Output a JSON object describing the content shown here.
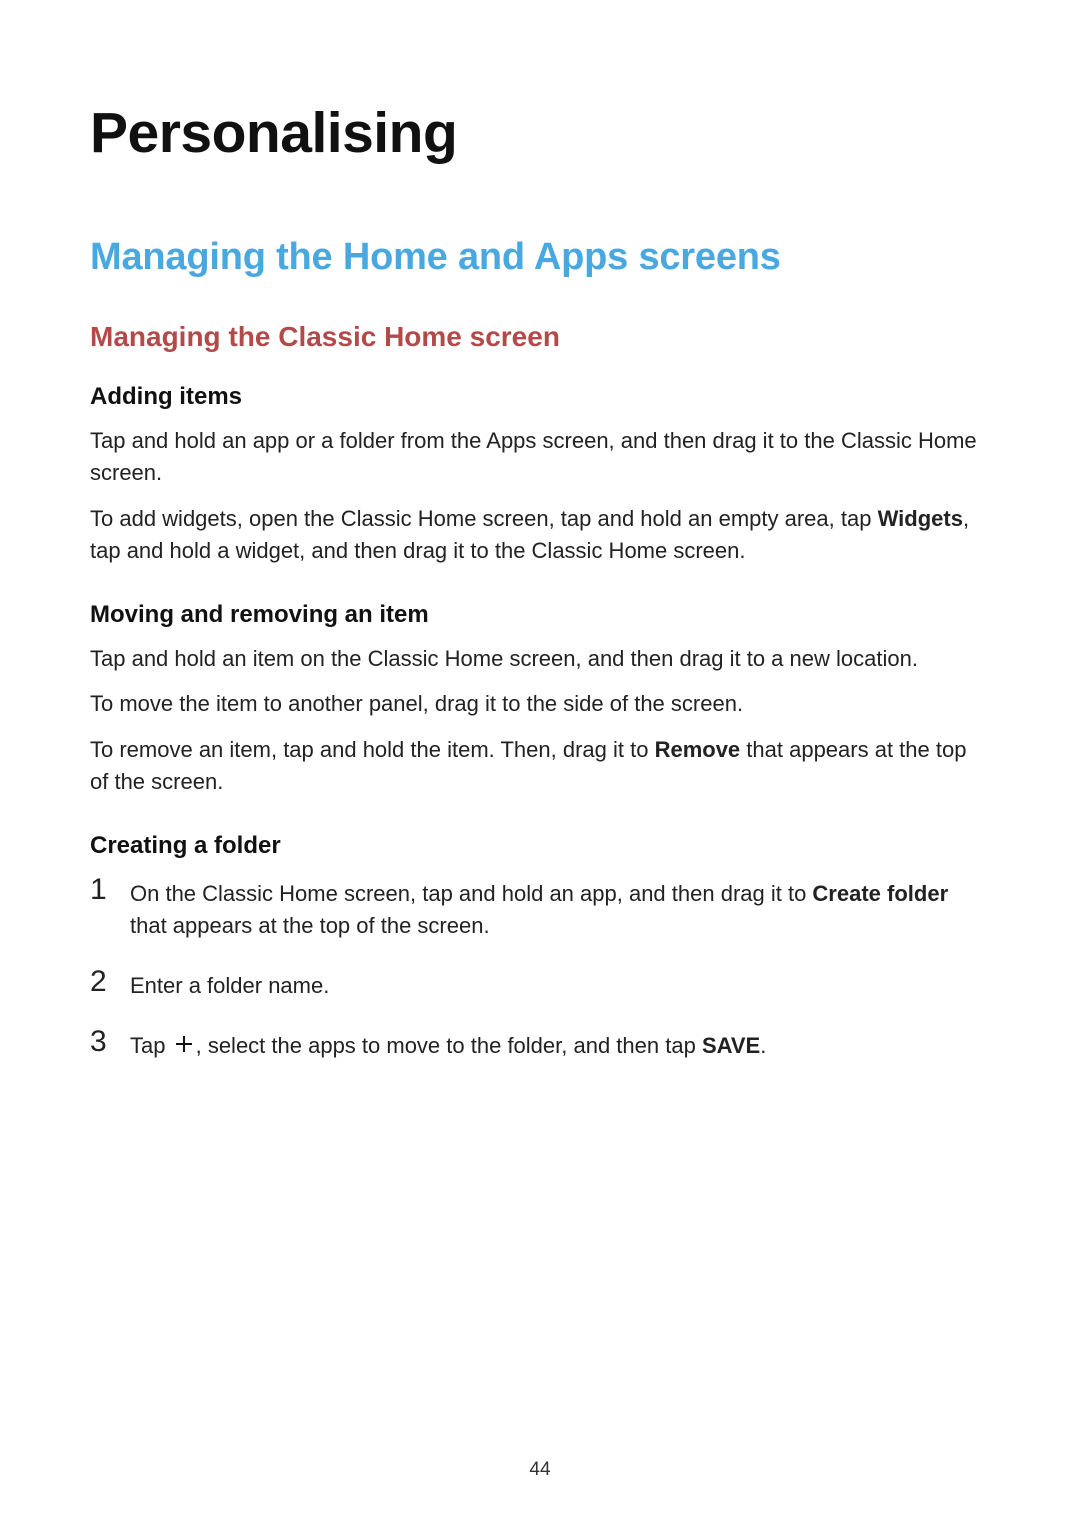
{
  "page": {
    "title": "Personalising",
    "section": "Managing the Home and Apps screens",
    "subsection": "Managing the Classic Home screen",
    "pageNumber": "44"
  },
  "topics": {
    "adding": {
      "heading": "Adding items",
      "p1a": "Tap and hold an app or a folder from the Apps screen, and then drag it to the Classic Home screen.",
      "p2a": "To add widgets, open the Classic Home screen, tap and hold an empty area, tap ",
      "p2bold": "Widgets",
      "p2b": ", tap and hold a widget, and then drag it to the Classic Home screen."
    },
    "moving": {
      "heading": "Moving and removing an item",
      "p1": "Tap and hold an item on the Classic Home screen, and then drag it to a new location.",
      "p2": "To move the item to another panel, drag it to the side of the screen.",
      "p3a": "To remove an item, tap and hold the item. Then, drag it to ",
      "p3bold": "Remove",
      "p3b": " that appears at the top of the screen."
    },
    "creating": {
      "heading": "Creating a folder",
      "step1": {
        "num": "1",
        "a": "On the Classic Home screen, tap and hold an app, and then drag it to ",
        "bold": "Create folder",
        "b": " that appears at the top of the screen."
      },
      "step2": {
        "num": "2",
        "text": "Enter a folder name."
      },
      "step3": {
        "num": "3",
        "a": "Tap ",
        "b": ", select the apps to move to the folder, and then tap ",
        "bold": "SAVE",
        "c": "."
      }
    }
  }
}
